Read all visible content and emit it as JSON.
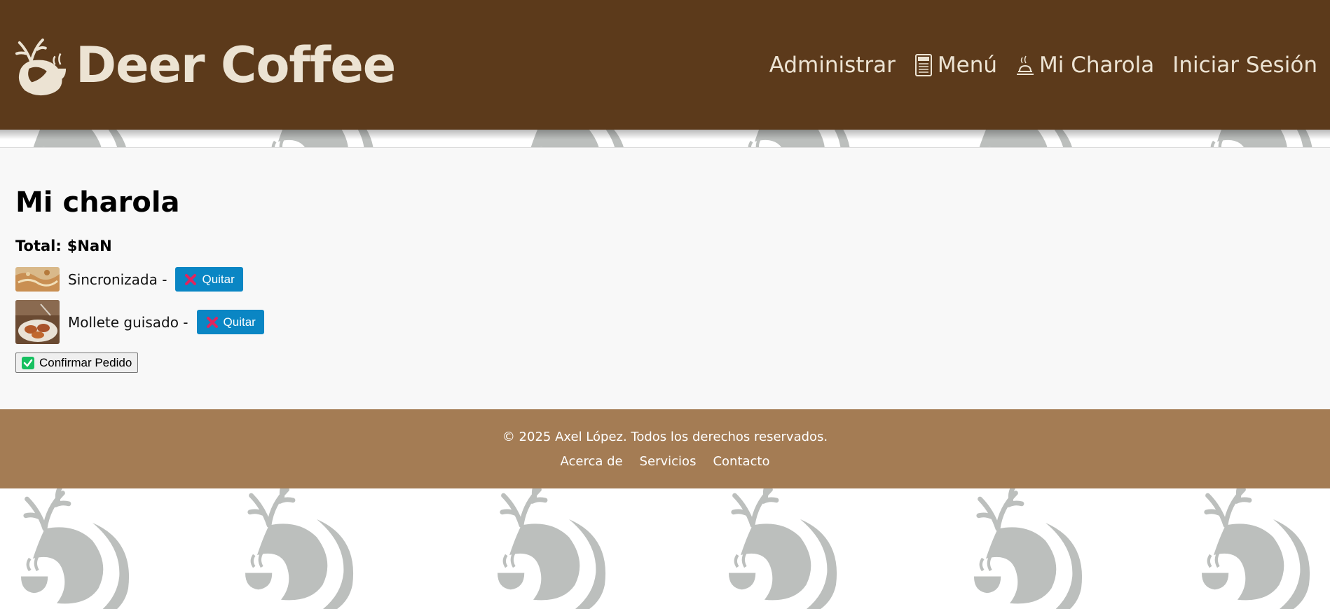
{
  "app": {
    "brand_name": "Deer Coffee",
    "logo_icon": "deer-coffee-logo"
  },
  "nav": {
    "items": [
      {
        "label": "Administrar",
        "icon": null
      },
      {
        "label": "Menú",
        "icon": "menu-card-icon"
      },
      {
        "label": "Mi Charola",
        "icon": "tray-icon"
      },
      {
        "label": "Iniciar Sesión",
        "icon": null
      }
    ]
  },
  "cart": {
    "title": "Mi charola",
    "total_label": "Total:",
    "total_value": "$NaN",
    "items": [
      {
        "name": "Sincronizada -",
        "remove_label": "Quitar"
      },
      {
        "name": "Mollete guisado -",
        "remove_label": "Quitar"
      }
    ],
    "confirm_label": "Confirmar Pedido"
  },
  "footer": {
    "copyright": "© 2025 Axel López. Todos los derechos reservados.",
    "links": [
      "Acerca de",
      "Servicios",
      "Contacto"
    ]
  },
  "colors": {
    "header_bg": "#5c3a1b",
    "header_text": "#ece3d3",
    "footer_bg": "#a47c54",
    "remove_button": "#0a86c4",
    "remove_x": "#e0245e",
    "confirm_check": "#16c060",
    "pattern": "#bcbfbd"
  }
}
